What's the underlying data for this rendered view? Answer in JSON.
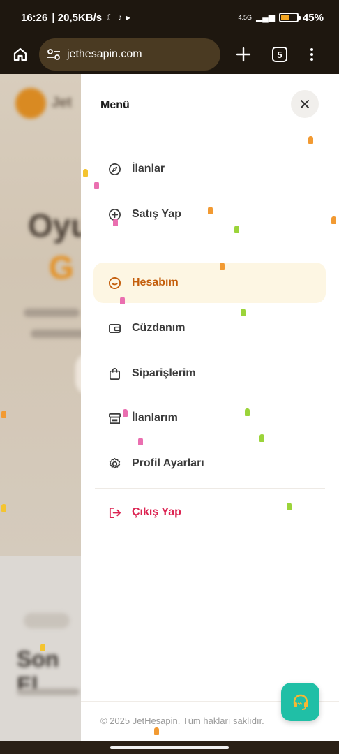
{
  "status_bar": {
    "time": "16:26",
    "net_speed": "| 20,5KB/s",
    "net_type": "4.5G",
    "battery": "45%",
    "battery_level": 0.45
  },
  "browser": {
    "url": "jethesapin.com",
    "tab_count": "5"
  },
  "background_page": {
    "logo_text": "Jet",
    "hero_line1": "Oyu",
    "hero_line2": "G",
    "section_pill": "",
    "section_title": "Son El"
  },
  "drawer": {
    "title": "Menü",
    "items": [
      {
        "label": "İlanlar",
        "icon": "compass-icon",
        "active": false
      },
      {
        "label": "Satış Yap",
        "icon": "plus-circle-icon",
        "active": false
      },
      {
        "label": "Hesabım",
        "icon": "smile-icon",
        "active": true
      },
      {
        "label": "Cüzdanım",
        "icon": "wallet-icon",
        "active": false
      },
      {
        "label": "Siparişlerim",
        "icon": "shopping-bag-icon",
        "active": false
      },
      {
        "label": "İlanlarım",
        "icon": "store-icon",
        "active": false
      },
      {
        "label": "Profil Ayarları",
        "icon": "gear-icon",
        "active": false
      }
    ],
    "logout": {
      "label": "Çıkış Yap",
      "icon": "logout-icon"
    },
    "footer": "© 2025 JetHesapin. Tüm hakları saklıdır."
  },
  "colors": {
    "accent": "#c45e0c",
    "active_bg": "#fdf6e3",
    "logout": "#dc2452",
    "support": "#20bfa6"
  }
}
